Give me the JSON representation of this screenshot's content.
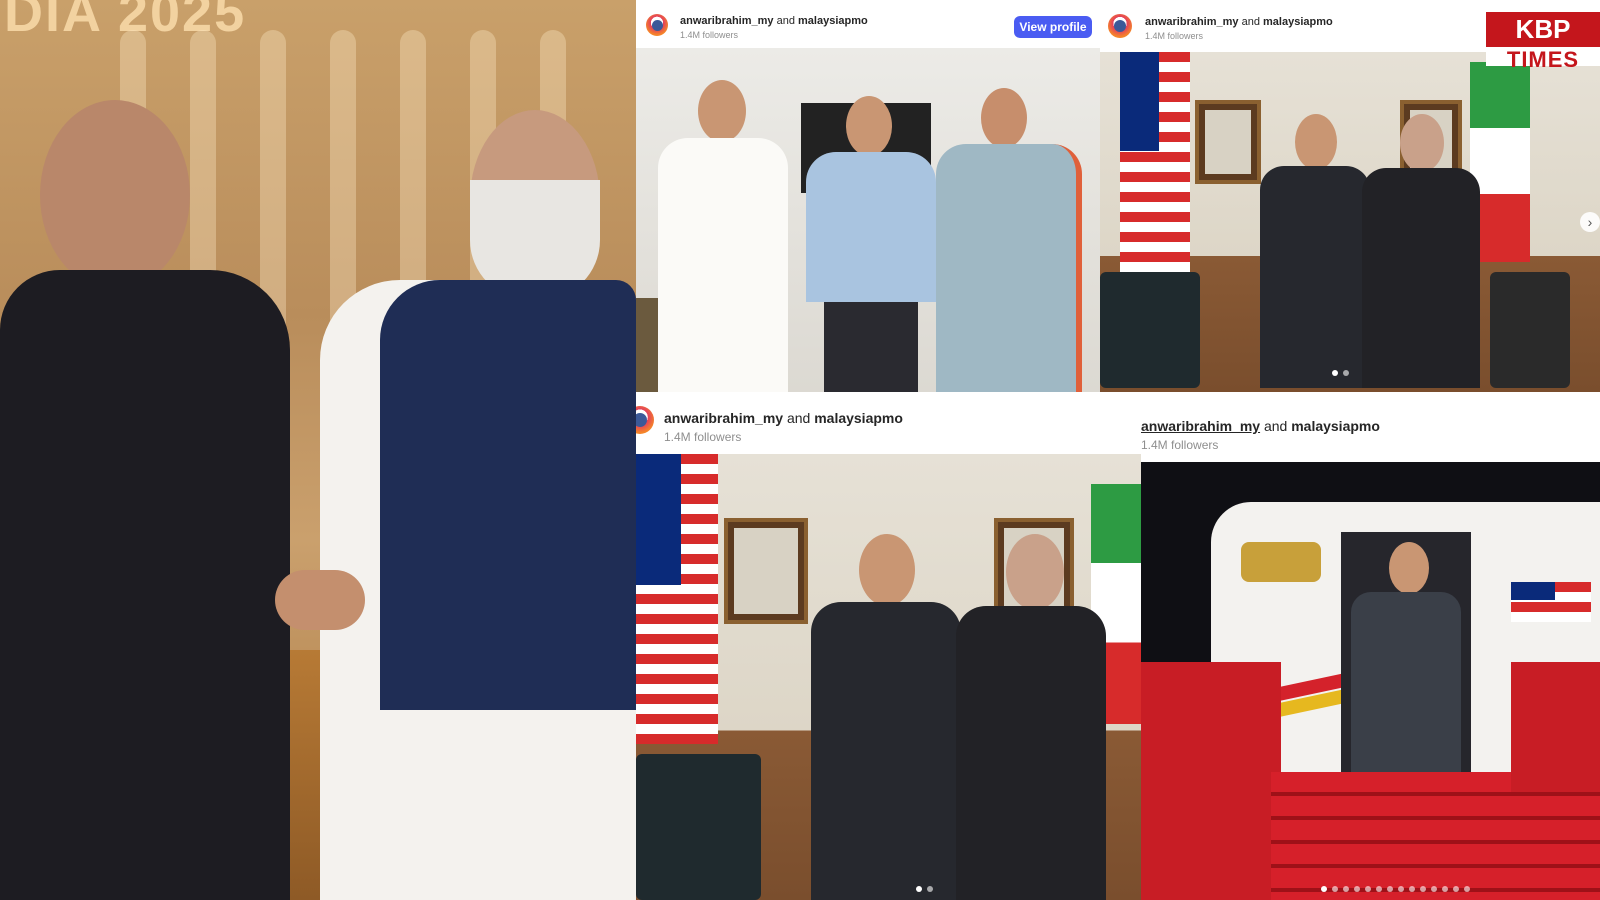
{
  "left_video": {
    "banner_text": "DIA 2025"
  },
  "posts": [
    {
      "account": "anwaribrahim_my",
      "connector": "and",
      "collaborator": "malaysiapmo",
      "followers": "1.4M followers",
      "button_label": "View profile"
    },
    {
      "account": "anwaribrahim_my",
      "connector": "and",
      "collaborator": "malaysiapmo",
      "followers": "1.4M followers"
    },
    {
      "account": "anwaribrahim_my",
      "connector": "and",
      "collaborator": "malaysiapmo",
      "followers": "1.4M followers"
    },
    {
      "account": "anwaribrahim_my",
      "connector": "and",
      "collaborator": "malaysiapmo",
      "followers": "1.4M followers"
    }
  ],
  "logo": {
    "line1": "KBP",
    "line2": "TIMES"
  },
  "colors": {
    "button_blue": "#4a5cf2",
    "logo_red": "#c4161c"
  },
  "icons": {
    "next": "chevron-right-icon"
  }
}
